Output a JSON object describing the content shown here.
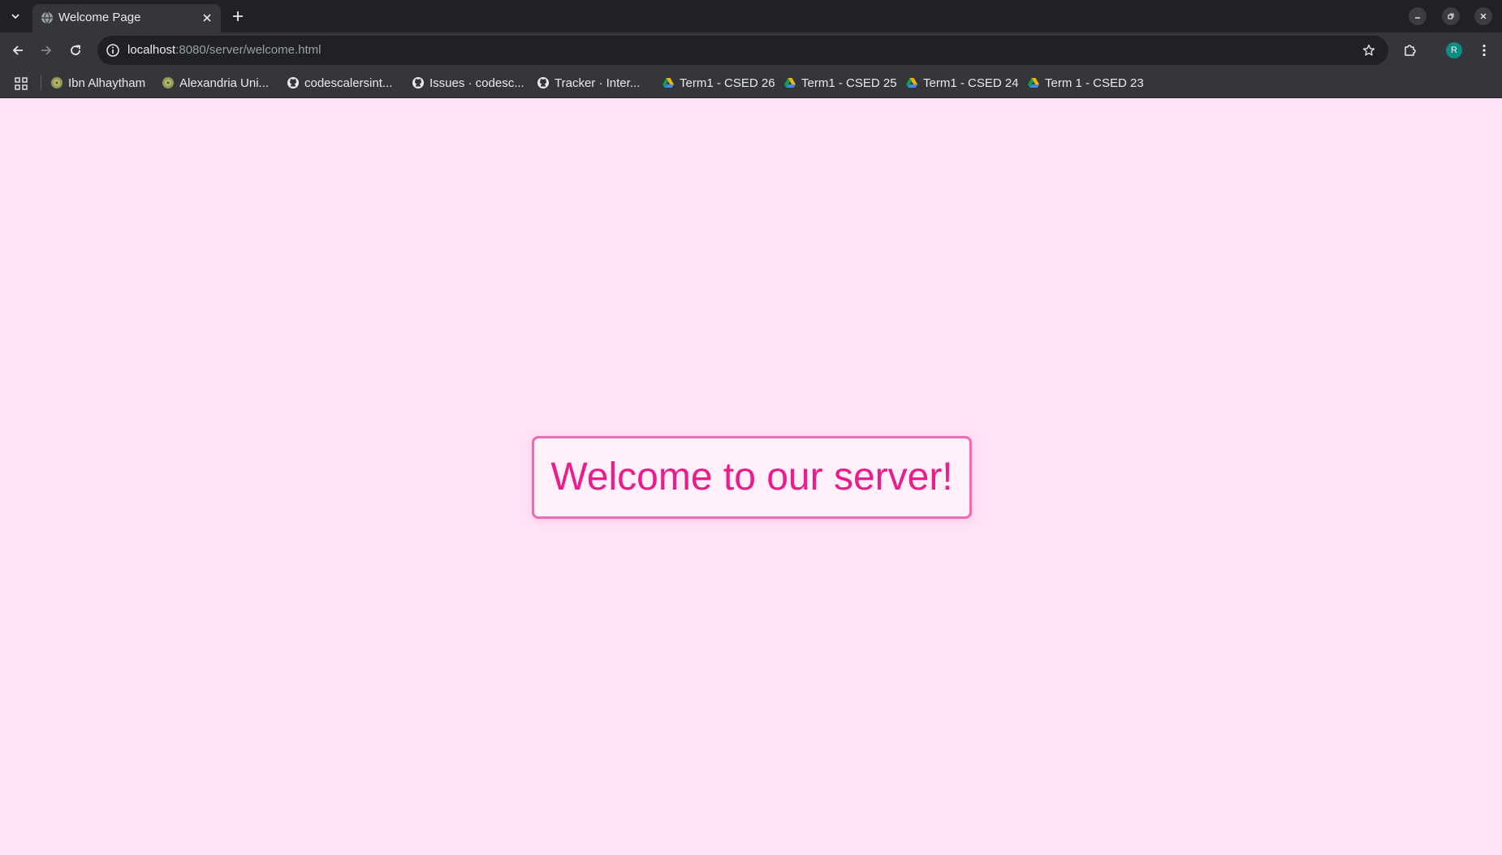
{
  "tab": {
    "title": "Welcome Page",
    "favicon": "globe-icon"
  },
  "address_bar": {
    "host": "localhost",
    "path": ":8080/server/welcome.html"
  },
  "bookmarks": [
    {
      "label": "Ibn Alhaytham",
      "icon": "university-seal-icon"
    },
    {
      "label": "Alexandria Uni...",
      "icon": "university-seal-icon"
    },
    {
      "label": "codescalersint...",
      "icon": "github-icon"
    },
    {
      "label": "Issues · codesc...",
      "icon": "github-icon"
    },
    {
      "label": "Tracker · Inter...",
      "icon": "github-icon"
    },
    {
      "label": "Term1 - CSED 26",
      "icon": "google-drive-icon"
    },
    {
      "label": "Term1 - CSED 25",
      "icon": "google-drive-icon"
    },
    {
      "label": "Term1 - CSED 24",
      "icon": "google-drive-icon"
    },
    {
      "label": "Term 1 - CSED 23",
      "icon": "google-drive-icon"
    }
  ],
  "profile": {
    "initial": "R",
    "color": "#0b8d84"
  },
  "page": {
    "heading": "Welcome to our server!",
    "background_color": "#ffe2f6",
    "text_color": "#e91e8c",
    "border_color": "#f06bb3"
  }
}
